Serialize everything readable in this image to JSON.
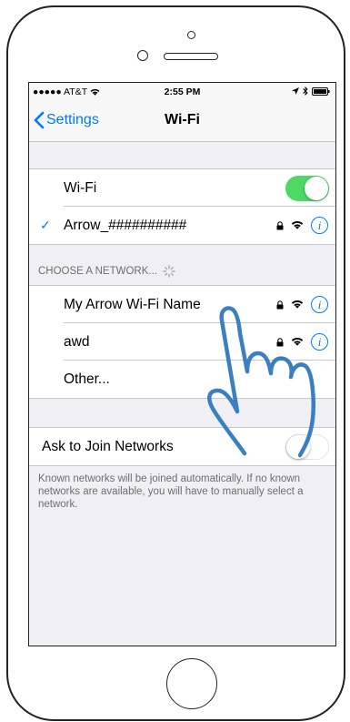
{
  "status_bar": {
    "carrier": "●●●●● AT&T",
    "time": "2:55 PM"
  },
  "nav": {
    "back_label": "Settings",
    "title": "Wi-Fi"
  },
  "wifi_section": {
    "toggle_label": "Wi-Fi",
    "toggle_on": true,
    "connected_network": "Arrow_##########"
  },
  "networks_section": {
    "header": "CHOOSE A NETWORK...",
    "networks": [
      {
        "name": "My Arrow Wi-Fi Name",
        "locked": true
      },
      {
        "name": "awd",
        "locked": true
      }
    ],
    "other_label": "Other..."
  },
  "ask_section": {
    "label": "Ask to Join Networks",
    "toggle_on": false,
    "footer": "Known networks will be joined automatically. If no known networks are available, you will have to manually select a network."
  },
  "colors": {
    "accent": "#007aff",
    "toggle_on": "#4cd964",
    "hand_stroke": "#3a7fc1"
  },
  "icons": [
    "wifi-icon",
    "lock-icon",
    "info-icon",
    "checkmark-icon",
    "chevron-left-icon",
    "battery-icon",
    "bluetooth-icon",
    "location-arrow-icon",
    "spinner-icon",
    "pointing-hand-icon"
  ]
}
